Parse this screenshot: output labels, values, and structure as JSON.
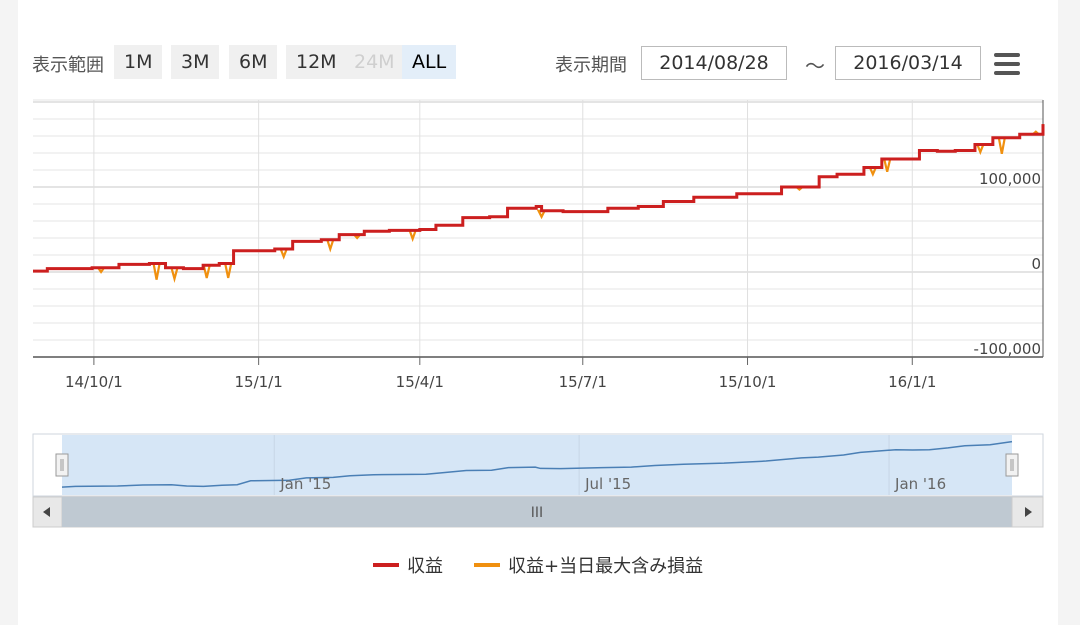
{
  "range_selector": {
    "label": "表示範囲",
    "buttons": [
      {
        "label": "1M",
        "state": "normal"
      },
      {
        "label": "3M",
        "state": "normal"
      },
      {
        "label": "6M",
        "state": "normal"
      },
      {
        "label": "12M",
        "state": "normal"
      },
      {
        "label": "24M",
        "state": "disabled"
      },
      {
        "label": "ALL",
        "state": "active"
      }
    ]
  },
  "period": {
    "label": "表示期間",
    "from": "2014/08/28",
    "separator": "〜",
    "to": "2016/03/14"
  },
  "menu_icon": "hamburger-icon",
  "navigator": {
    "labels": [
      "Jan '15",
      "Jul '15",
      "Jan '16"
    ],
    "scrollbar_grip": "III"
  },
  "chart_data": {
    "type": "line",
    "x_tick_labels": [
      "14/10/1",
      "15/1/1",
      "15/4/1",
      "15/7/1",
      "15/10/1",
      "16/1/1"
    ],
    "y_tick_labels": [
      "100,000",
      "0",
      "-100,000"
    ],
    "ylim": [
      -100000,
      200000
    ],
    "grid": true,
    "legend_position": "bottom-center",
    "series": [
      {
        "name": "収益",
        "color": "#cc1f1f",
        "points": [
          [
            "2014-08-28",
            1000
          ],
          [
            "2014-09-05",
            4000
          ],
          [
            "2014-09-30",
            5000
          ],
          [
            "2014-10-15",
            9000
          ],
          [
            "2014-11-01",
            10000
          ],
          [
            "2014-11-10",
            5000
          ],
          [
            "2014-11-20",
            4000
          ],
          [
            "2014-12-01",
            8000
          ],
          [
            "2014-12-10",
            10000
          ],
          [
            "2014-12-18",
            25000
          ],
          [
            "2015-01-10",
            27000
          ],
          [
            "2015-01-20",
            36000
          ],
          [
            "2015-02-05",
            38000
          ],
          [
            "2015-02-15",
            44000
          ],
          [
            "2015-03-01",
            48000
          ],
          [
            "2015-03-15",
            49000
          ],
          [
            "2015-04-01",
            50000
          ],
          [
            "2015-04-10",
            55000
          ],
          [
            "2015-04-25",
            64000
          ],
          [
            "2015-05-10",
            65000
          ],
          [
            "2015-05-20",
            75000
          ],
          [
            "2015-06-05",
            77000
          ],
          [
            "2015-06-08",
            72000
          ],
          [
            "2015-06-20",
            71000
          ],
          [
            "2015-07-15",
            75000
          ],
          [
            "2015-08-01",
            77000
          ],
          [
            "2015-08-15",
            83000
          ],
          [
            "2015-09-01",
            88000
          ],
          [
            "2015-09-25",
            92000
          ],
          [
            "2015-10-20",
            100000
          ],
          [
            "2015-11-10",
            112000
          ],
          [
            "2015-11-20",
            115000
          ],
          [
            "2015-12-05",
            123000
          ],
          [
            "2015-12-15",
            133000
          ],
          [
            "2016-01-05",
            143000
          ],
          [
            "2016-01-15",
            142000
          ],
          [
            "2016-01-25",
            143000
          ],
          [
            "2016-02-05",
            150000
          ],
          [
            "2016-02-15",
            158000
          ],
          [
            "2016-03-01",
            162000
          ],
          [
            "2016-03-14",
            174000
          ]
        ]
      },
      {
        "name": "収益+当日最大含み損益",
        "color": "#f0900f",
        "dips": [
          [
            "2014-10-05",
            0
          ],
          [
            "2014-11-05",
            -9000
          ],
          [
            "2014-11-15",
            -8000
          ],
          [
            "2014-12-03",
            -7000
          ],
          [
            "2014-12-15",
            -7000
          ],
          [
            "2015-01-15",
            18000
          ],
          [
            "2015-02-10",
            27000
          ],
          [
            "2015-02-25",
            40000
          ],
          [
            "2015-03-28",
            39000
          ],
          [
            "2015-06-08",
            65000
          ],
          [
            "2015-06-15",
            72000
          ],
          [
            "2015-10-30",
            97000
          ],
          [
            "2015-12-10",
            115000
          ],
          [
            "2015-12-18",
            118000
          ],
          [
            "2016-02-08",
            141000
          ],
          [
            "2016-02-20",
            139000
          ],
          [
            "2016-03-10",
            165000
          ]
        ]
      }
    ]
  }
}
